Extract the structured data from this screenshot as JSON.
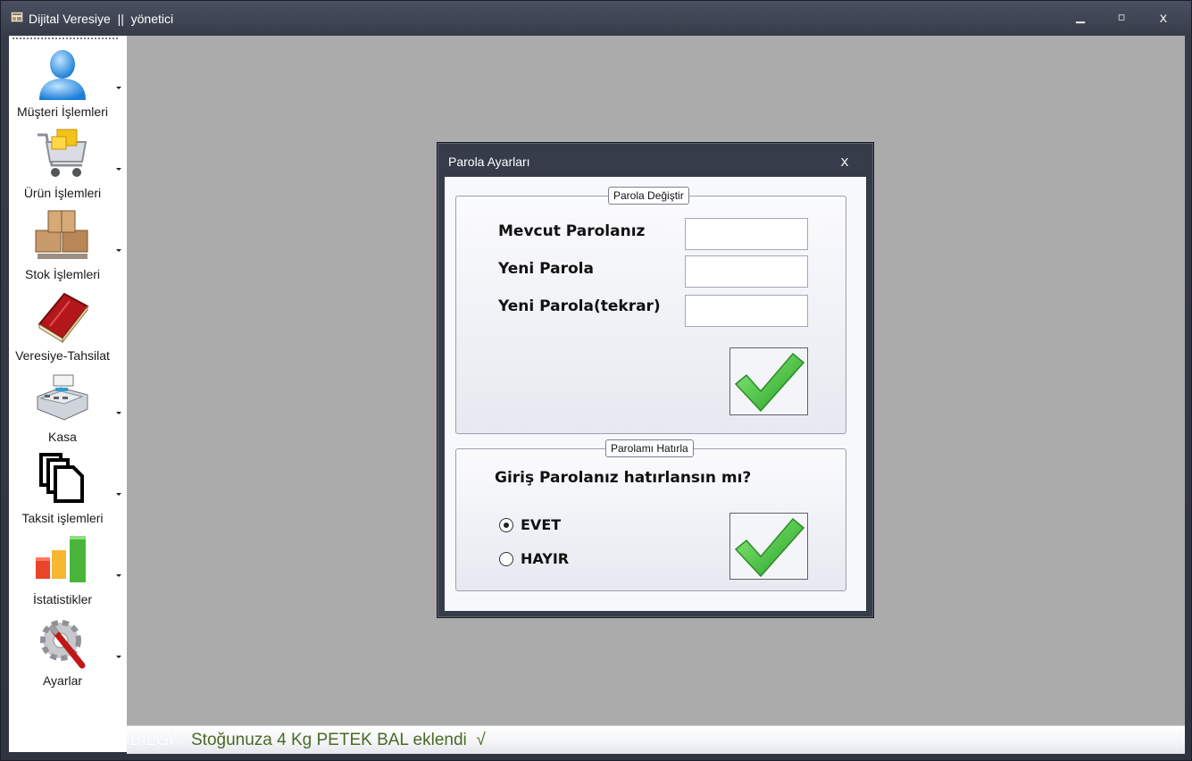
{
  "window": {
    "title": "Dijital Veresiye  ||  yönetici",
    "minimize_glyph": "▁",
    "maximize_glyph": "▫",
    "close_glyph": "x"
  },
  "sidebar": {
    "items": [
      {
        "label": "Müşteri İşlemleri",
        "icon": "user-icon"
      },
      {
        "label": "Ürün İşlemleri",
        "icon": "shopping-cart-icon"
      },
      {
        "label": "Stok İşlemleri",
        "icon": "boxes-icon"
      },
      {
        "label": "Veresiye-Tahsilat",
        "icon": "red-book-icon"
      },
      {
        "label": "Kasa",
        "icon": "cash-register-icon"
      },
      {
        "label": "Taksit işlemleri",
        "icon": "documents-icon"
      },
      {
        "label": "İstatistikler",
        "icon": "bar-chart-icon"
      },
      {
        "label": "Ayarlar",
        "icon": "settings-icon"
      }
    ]
  },
  "dialog": {
    "title": "Parola Ayarları",
    "close_glyph": "x",
    "change_group": {
      "legend": "Parola Değiştir",
      "current_label": "Mevcut Parolanız",
      "new_label": "Yeni Parola",
      "repeat_label": "Yeni Parola(tekrar)",
      "current_value": "",
      "new_value": "",
      "repeat_value": "",
      "confirm_icon": "green-check-icon"
    },
    "remember_group": {
      "legend": "Parolamı Hatırla",
      "question": "Giriş Parolanız hatırlansın mı?",
      "options": [
        {
          "label": "EVET",
          "selected": true
        },
        {
          "label": "HAYIR",
          "selected": false
        }
      ],
      "confirm_icon": "green-check-icon"
    }
  },
  "status": {
    "prefix": "BİLGİ :",
    "message": "Stoğunuza 4 Kg PETEK BAL eklendi  √"
  },
  "colors": {
    "chrome": "#373c4a",
    "workspace": "#ababab",
    "status_text": "#496a25",
    "check_green": "#3fb83a"
  }
}
